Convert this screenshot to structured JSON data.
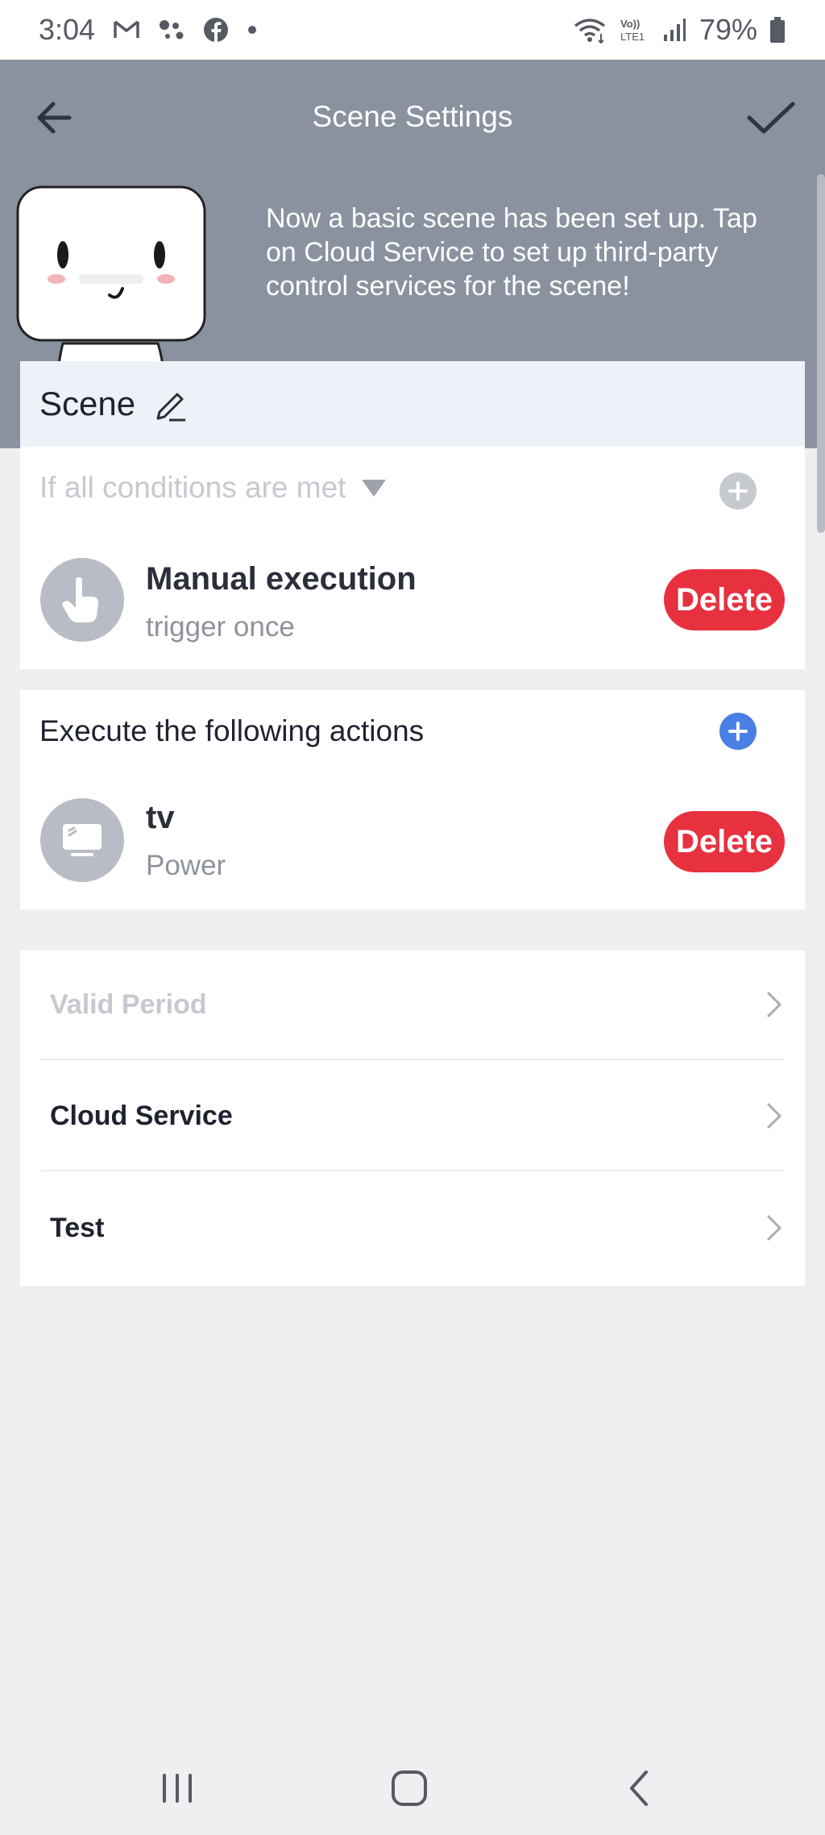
{
  "status_bar": {
    "time": "3:04",
    "battery_percent": "79%",
    "icons": [
      "gmail-icon",
      "dots-icon",
      "facebook-icon",
      "dot-icon",
      "wifi-icon",
      "volte-icon",
      "signal-icon",
      "battery-icon"
    ],
    "volte_label": "Vo)) LTE1"
  },
  "header": {
    "title": "Scene Settings",
    "tip": "Now a basic scene has been set up. Tap on Cloud Service to set up third-party control services for the scene!",
    "background_color": "#8a929f"
  },
  "scene": {
    "name": "Scene"
  },
  "conditions": {
    "heading": "If all conditions are met",
    "items": [
      {
        "icon": "hand-tap-icon",
        "title": "Manual execution",
        "subtitle": "trigger once",
        "delete_label": "Delete"
      }
    ]
  },
  "actions": {
    "heading": "Execute the following actions",
    "items": [
      {
        "icon": "tv-icon",
        "title": "tv",
        "subtitle": "Power",
        "delete_label": "Delete"
      }
    ]
  },
  "settings": {
    "items": [
      {
        "label": "Valid Period",
        "disabled": true
      },
      {
        "label": "Cloud Service",
        "disabled": false
      },
      {
        "label": "Test",
        "disabled": false
      }
    ]
  },
  "colors": {
    "delete": "#e8313f",
    "accent": "#4a7fe6",
    "muted": "#c6c9cf"
  }
}
